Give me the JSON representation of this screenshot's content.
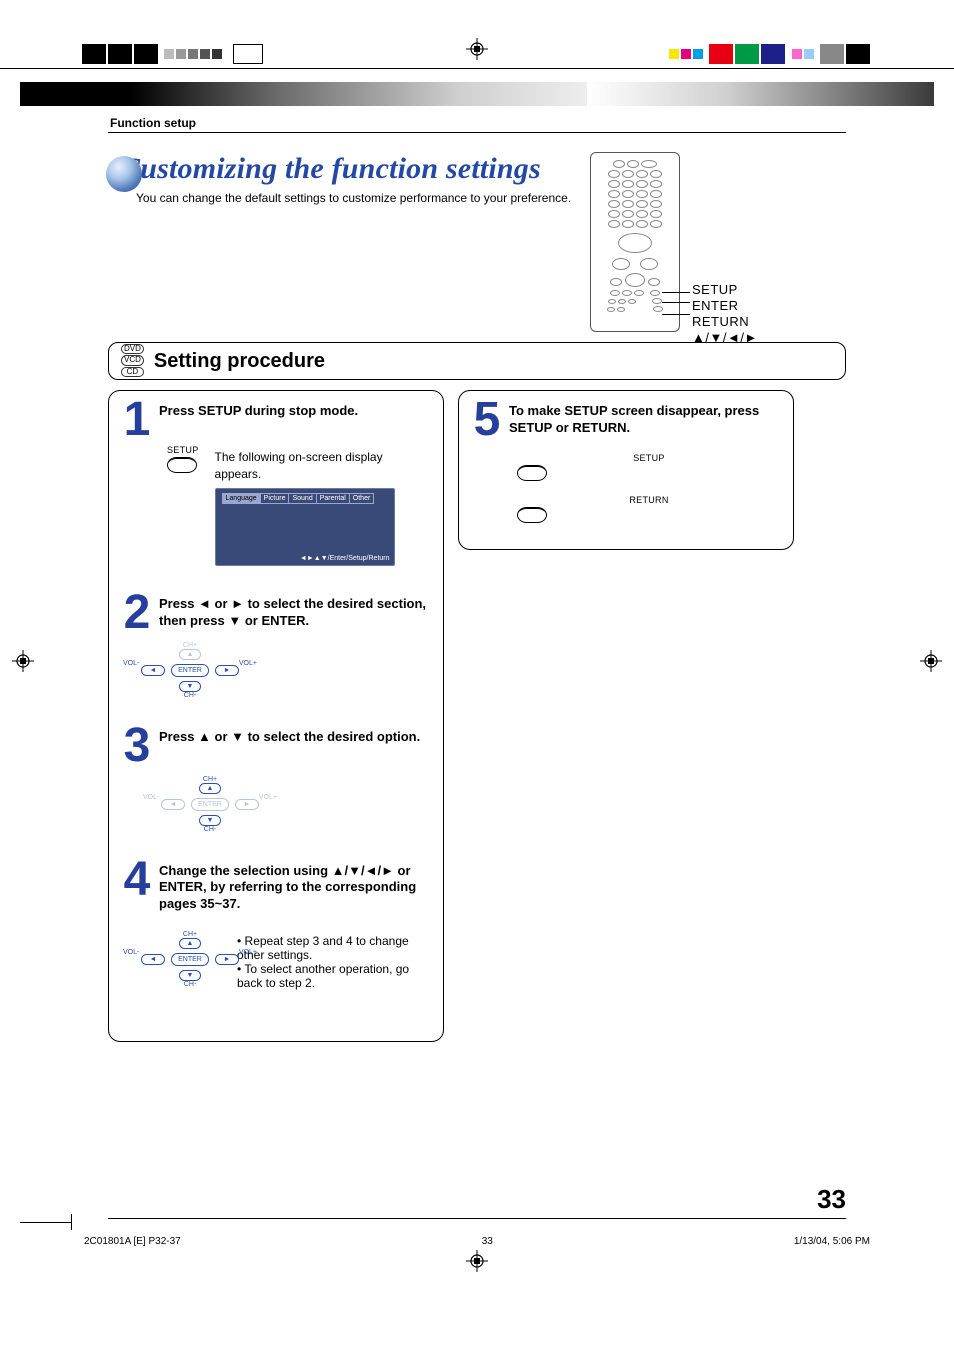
{
  "header": {
    "section_label": "Function setup"
  },
  "title": {
    "heading": "Customizing the function settings",
    "subtitle": "You can change the default settings to customize performance to your preference."
  },
  "remote_labels": {
    "l1": "SETUP",
    "l2": "ENTER",
    "l3": "RETURN",
    "l4": "▲/▼/◄/►"
  },
  "disc_badges": {
    "b1": "DVD",
    "b2": "VCD",
    "b3": "CD"
  },
  "procedure_title": "Setting procedure",
  "steps": {
    "s1": {
      "num": "1",
      "title": "Press SETUP during stop mode.",
      "keylabel": "SETUP",
      "body": "The following on-screen display appears."
    },
    "osd": {
      "tab1": "Language",
      "tab2": "Picture",
      "tab3": "Sound",
      "tab4": "Parental",
      "tab5": "Other",
      "hint": "◄►▲▼/Enter/Setup/Return"
    },
    "s2": {
      "num": "2",
      "title": "Press ◄ or ► to select the desired section, then press ▼ or ENTER."
    },
    "s3": {
      "num": "3",
      "title": "Press ▲ or ▼ to select the desired option."
    },
    "s4": {
      "num": "4",
      "title": "Change the selection using ▲/▼/◄/► or ENTER, by referring to the corresponding pages 35~37.",
      "bullet1": "Repeat step 3 and 4 to change other settings.",
      "bullet2": "To select another operation, go back to step 2."
    },
    "s5": {
      "num": "5",
      "title": "To make SETUP screen disappear, press SETUP or RETURN.",
      "key1": "SETUP",
      "key2": "RETURN"
    },
    "dpad": {
      "ch_plus": "CH+",
      "ch_minus": "CH-",
      "vol_minus": "VOL-",
      "vol_plus": "VOL+",
      "enter": "ENTER",
      "up": "▲",
      "down": "▼",
      "left": "◄",
      "right": "►"
    }
  },
  "page_number": "33",
  "footer": {
    "left": "2C01801A [E] P32-37",
    "mid": "33",
    "right": "1/13/04, 5:06 PM"
  }
}
